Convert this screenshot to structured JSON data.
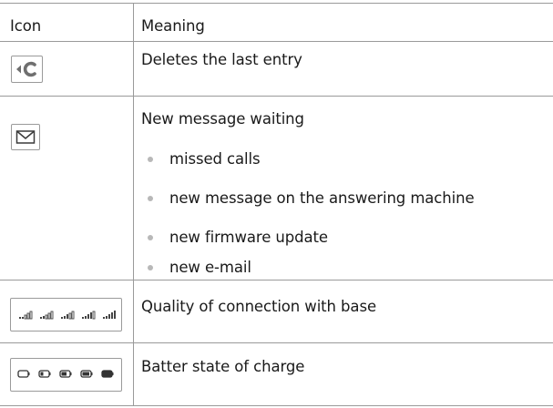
{
  "table": {
    "headers": {
      "icon": "Icon",
      "meaning": "Meaning"
    },
    "rows": [
      {
        "icon": "clear-icon",
        "meaning": "Deletes the last entry",
        "bullets": []
      },
      {
        "icon": "envelope-icon",
        "meaning": "New message waiting",
        "bullets": [
          "missed calls",
          "new message on the answering machine",
          "new firmware update",
          "new e-mail"
        ]
      },
      {
        "icon": "signal-strength-icons",
        "meaning": "Quality of connection with base",
        "bullets": []
      },
      {
        "icon": "battery-charge-icons",
        "meaning": "Batter state of charge",
        "bullets": []
      }
    ]
  },
  "colors": {
    "rule": "#9a9a9a",
    "text": "#1a1a1a",
    "bullet": "#b8b8b8",
    "icon": "#6f6f6f"
  }
}
